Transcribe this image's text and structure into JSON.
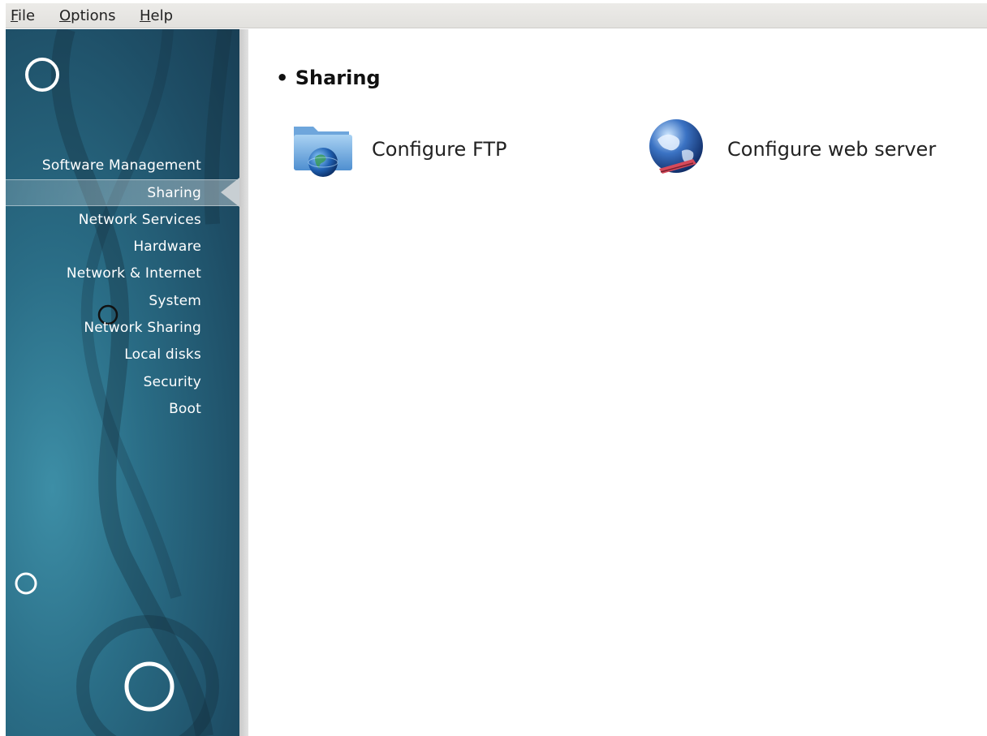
{
  "menubar": {
    "file": {
      "mnemonic": "F",
      "rest": "ile"
    },
    "options": {
      "mnemonic": "O",
      "rest": "ptions"
    },
    "help": {
      "mnemonic": "H",
      "rest": "elp"
    }
  },
  "sidebar": {
    "items": [
      {
        "label": "Software Management"
      },
      {
        "label": "Sharing"
      },
      {
        "label": "Network Services"
      },
      {
        "label": "Hardware"
      },
      {
        "label": "Network & Internet"
      },
      {
        "label": "System"
      },
      {
        "label": "Network Sharing"
      },
      {
        "label": "Local disks"
      },
      {
        "label": "Security"
      },
      {
        "label": "Boot"
      }
    ],
    "active": "Sharing"
  },
  "main": {
    "section_title": "Sharing",
    "tools": [
      {
        "label": "Configure FTP",
        "icon": "ftp-folder-globe-icon"
      },
      {
        "label": "Configure web server",
        "icon": "web-globe-icon"
      }
    ]
  },
  "colors": {
    "sidebar_bg": "#2a6d86",
    "active_item_bg": "#8fa9b6",
    "main_bg": "#ffffff"
  }
}
